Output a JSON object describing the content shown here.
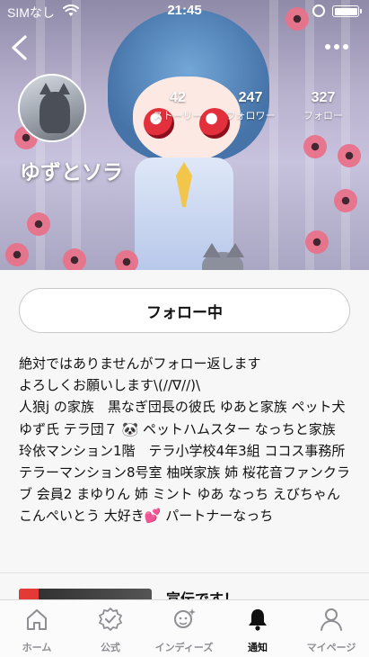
{
  "status_bar": {
    "carrier": "SIMなし",
    "time": "21:45"
  },
  "profile": {
    "name": "ゆずとソラ",
    "stats": [
      {
        "value": "42",
        "label": "ストーリー"
      },
      {
        "value": "247",
        "label": "フォロワー"
      },
      {
        "value": "327",
        "label": "フォロー"
      }
    ],
    "follow_button": "フォロー中",
    "bio_lines": [
      "絶対ではありませんがフォロー返します",
      "よろしくお願いします\\(//∇//)\\",
      "人狼j の家族　黒なぎ団長の彼氏 ゆあと家族 ペット犬 ゆず氏 テラ団７ 🐼 ペットハムスター なっちと家族 玲依マンション1階　テラ小学校4年3組 ココス事務所 テラーマンション8号室 柚咲家族 姉 桜花音ファンクラブ 会員2 まゆりん 姉 ミント ゆあ なっち えびちゃん こんぺいとう 大好き💕 パートナーなっち"
    ]
  },
  "post_preview": {
    "title": "宣伝です！"
  },
  "tabs": [
    {
      "label": "ホーム",
      "icon": "home-icon",
      "active": false
    },
    {
      "label": "公式",
      "icon": "badge-check-icon",
      "active": false
    },
    {
      "label": "インディーズ",
      "icon": "indies-icon",
      "active": false
    },
    {
      "label": "通知",
      "icon": "bell-icon",
      "active": true
    },
    {
      "label": "マイページ",
      "icon": "person-icon",
      "active": false
    }
  ],
  "colors": {
    "accent_text": "#111111",
    "inactive_tab": "#8e8e93",
    "flower": "#e8728a"
  }
}
